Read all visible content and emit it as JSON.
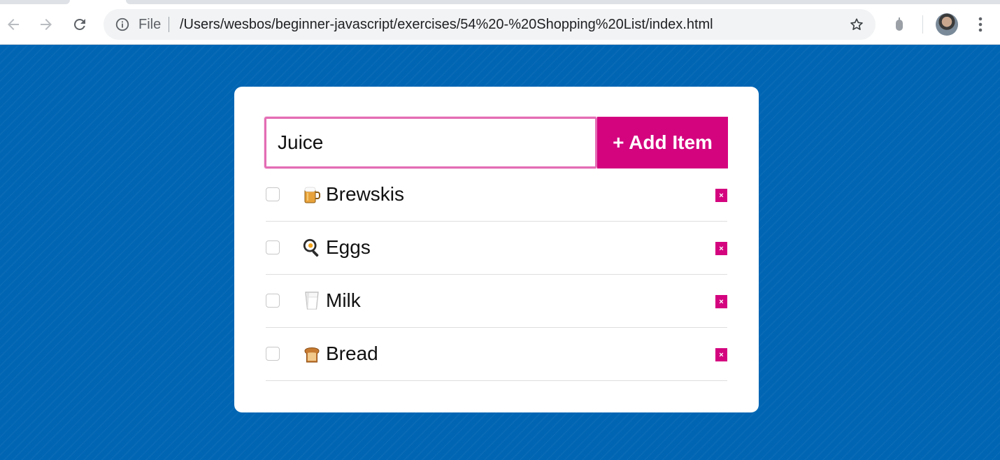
{
  "browser": {
    "url_scheme": "File",
    "url": "/Users/wesbos/beginner-javascript/exercises/54%20-%20Shopping%20List/index.html"
  },
  "form": {
    "input_value": "Juice",
    "add_button_label": "+ Add Item"
  },
  "items": [
    {
      "name": "Brewskis",
      "icon": "beer-mug-icon",
      "checked": false,
      "remove_label": "×"
    },
    {
      "name": "Eggs",
      "icon": "fried-egg-icon",
      "checked": false,
      "remove_label": "×"
    },
    {
      "name": "Milk",
      "icon": "glass-of-milk-icon",
      "checked": false,
      "remove_label": "×"
    },
    {
      "name": "Bread",
      "icon": "bread-icon",
      "checked": false,
      "remove_label": "×"
    }
  ],
  "colors": {
    "background": "#0065b3",
    "accent": "#d4047f",
    "input_border": "#e46db4"
  }
}
